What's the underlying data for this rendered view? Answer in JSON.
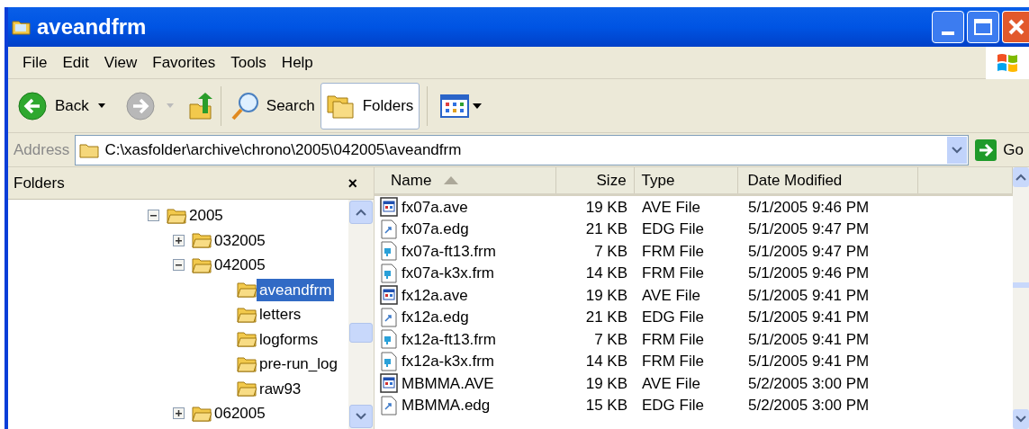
{
  "window": {
    "title": "aveandfrm"
  },
  "menu": [
    "File",
    "Edit",
    "View",
    "Favorites",
    "Tools",
    "Help"
  ],
  "toolbar": {
    "back": "Back",
    "search": "Search",
    "folders": "Folders"
  },
  "address": {
    "label": "Address",
    "value": "C:\\xasfolder\\archive\\chrono\\2005\\042005\\aveandfrm",
    "go": "Go"
  },
  "folders_pane": {
    "title": "Folders",
    "close": "×",
    "tree": [
      {
        "label": "2005",
        "expanded": true,
        "selected": false,
        "children": [
          {
            "label": "032005",
            "expanded": false,
            "selected": false
          },
          {
            "label": "042005",
            "expanded": true,
            "selected": false,
            "children": [
              {
                "label": "aveandfrm",
                "selected": true
              },
              {
                "label": "letters",
                "selected": false
              },
              {
                "label": "logforms",
                "selected": false
              },
              {
                "label": "pre-run_log",
                "selected": false
              },
              {
                "label": "raw93",
                "selected": false
              }
            ]
          },
          {
            "label": "062005",
            "expanded": false,
            "selected": false
          }
        ]
      }
    ]
  },
  "table": {
    "columns": [
      {
        "label": "Name",
        "sorted": true
      },
      {
        "label": "Size",
        "sorted": false
      },
      {
        "label": "Type",
        "sorted": false
      },
      {
        "label": "Date Modified",
        "sorted": false
      }
    ],
    "rows": [
      {
        "kind": "ave",
        "name": "fx07a.ave",
        "size": "19 KB",
        "type": "AVE File",
        "date": "5/1/2005 9:46 PM"
      },
      {
        "kind": "edg",
        "name": "fx07a.edg",
        "size": "21 KB",
        "type": "EDG File",
        "date": "5/1/2005 9:47 PM"
      },
      {
        "kind": "frm",
        "name": "fx07a-ft13.frm",
        "size": "7 KB",
        "type": "FRM File",
        "date": "5/1/2005 9:47 PM"
      },
      {
        "kind": "frm",
        "name": "fx07a-k3x.frm",
        "size": "14 KB",
        "type": "FRM File",
        "date": "5/1/2005 9:46 PM"
      },
      {
        "kind": "ave",
        "name": "fx12a.ave",
        "size": "19 KB",
        "type": "AVE File",
        "date": "5/1/2005 9:41 PM"
      },
      {
        "kind": "edg",
        "name": "fx12a.edg",
        "size": "21 KB",
        "type": "EDG File",
        "date": "5/1/2005 9:41 PM"
      },
      {
        "kind": "frm",
        "name": "fx12a-ft13.frm",
        "size": "7 KB",
        "type": "FRM File",
        "date": "5/1/2005 9:41 PM"
      },
      {
        "kind": "frm",
        "name": "fx12a-k3x.frm",
        "size": "14 KB",
        "type": "FRM File",
        "date": "5/1/2005 9:41 PM"
      },
      {
        "kind": "ave",
        "name": "MBMMA.AVE",
        "size": "19 KB",
        "type": "AVE File",
        "date": "5/2/2005 3:00 PM"
      },
      {
        "kind": "edg",
        "name": "MBMMA.edg",
        "size": "15 KB",
        "type": "EDG File",
        "date": "5/2/2005 3:00 PM"
      }
    ]
  }
}
